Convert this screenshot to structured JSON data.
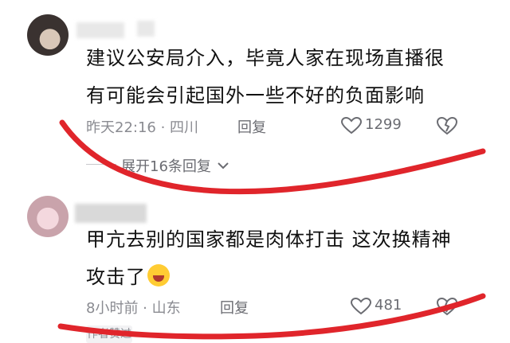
{
  "comments": [
    {
      "text_line1": "建议公安局介入，毕竟人家在现场直播很",
      "text_line2": "有可能会引起国外一些不好的负面影响",
      "time_location": "昨天22:16 · 四川",
      "reply_label": "回复",
      "likes": "1299",
      "expand_label": "展开16条回复"
    },
    {
      "text_line1": "甲亢去别的国家都是肉体打击 这次换精神",
      "text_line2": "攻击了",
      "time_location": "8小时前 · 山东",
      "reply_label": "回复",
      "likes": "481",
      "author_badge": "作者赞过"
    }
  ],
  "colors": {
    "annotation": "#e0252b",
    "meta": "#8a8b91"
  }
}
